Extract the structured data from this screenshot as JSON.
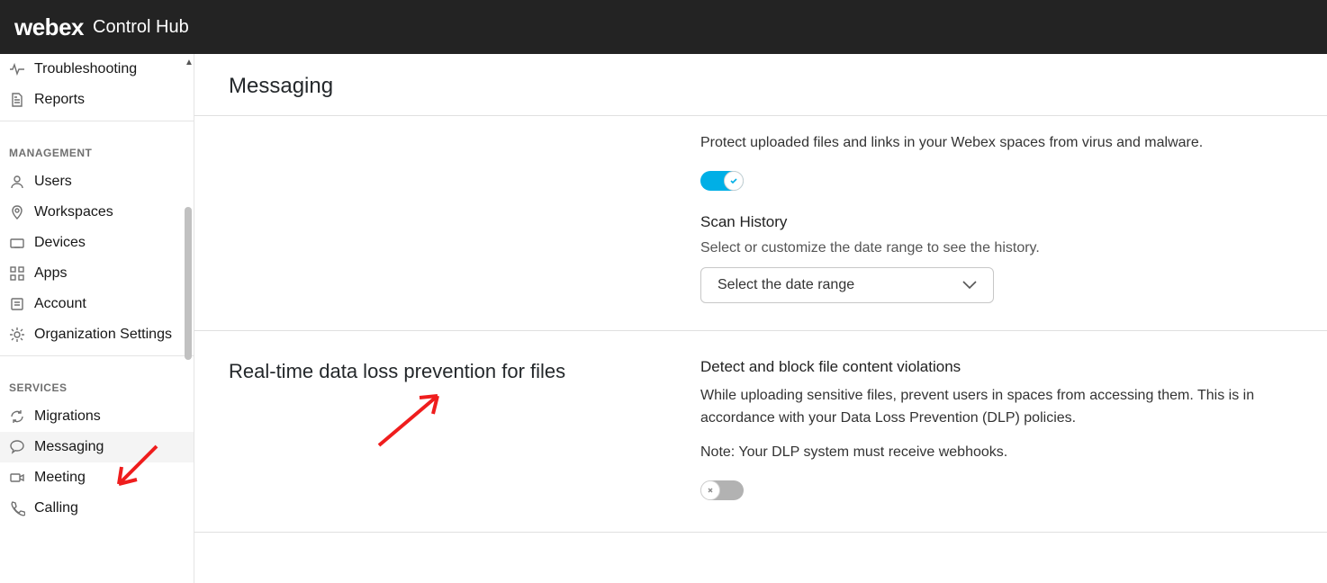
{
  "header": {
    "brand": "webex",
    "sub": "Control Hub"
  },
  "sidebar": {
    "top_items": [
      {
        "label": "Troubleshooting",
        "icon": "activity"
      },
      {
        "label": "Reports",
        "icon": "file"
      }
    ],
    "management_heading": "MANAGEMENT",
    "management_items": [
      {
        "label": "Users",
        "icon": "user"
      },
      {
        "label": "Workspaces",
        "icon": "pin"
      },
      {
        "label": "Devices",
        "icon": "device"
      },
      {
        "label": "Apps",
        "icon": "apps"
      },
      {
        "label": "Account",
        "icon": "account"
      },
      {
        "label": "Organization Settings",
        "icon": "gear"
      }
    ],
    "services_heading": "SERVICES",
    "services_items": [
      {
        "label": "Migrations",
        "icon": "refresh"
      },
      {
        "label": "Messaging",
        "icon": "chat",
        "active": true
      },
      {
        "label": "Meeting",
        "icon": "meeting"
      },
      {
        "label": "Calling",
        "icon": "phone"
      }
    ]
  },
  "main": {
    "title": "Messaging",
    "section1": {
      "desc": "Protect uploaded files and links in your Webex spaces from virus and malware.",
      "toggle_on": true,
      "scan_history_heading": "Scan History",
      "scan_history_hint": "Select or customize the date range to see the history.",
      "date_range_placeholder": "Select the date range"
    },
    "section2": {
      "left_title": "Real-time data loss prevention for files",
      "right_heading": "Detect and block file content violations",
      "right_desc": "While uploading sensitive files, prevent users in spaces from accessing them. This is in accordance with your Data Loss Prevention (DLP) policies.",
      "right_note": "Note: Your DLP system must receive webhooks.",
      "toggle_on": false
    }
  }
}
